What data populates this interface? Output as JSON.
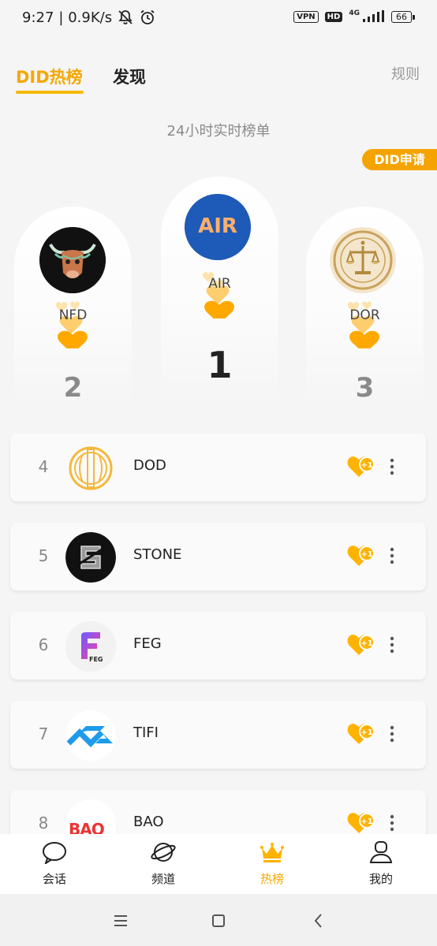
{
  "status_bar": {
    "time": "9:27",
    "network_speed": "| 0.9K/s",
    "vpn": "VPN",
    "hd": "HD",
    "signal_type": "4G",
    "battery": "66"
  },
  "tabs": [
    {
      "label": "DID热榜",
      "active": true
    },
    {
      "label": "发现",
      "active": false
    }
  ],
  "rules_label": "规则",
  "subtitle": "24小时实时榜单",
  "did_apply_label": "DID申请",
  "podium": [
    {
      "rank": "1",
      "name": "AIR",
      "logo_text": "AIR"
    },
    {
      "rank": "2",
      "name": "NFD"
    },
    {
      "rank": "3",
      "name": "DOR"
    }
  ],
  "list": [
    {
      "rank": "4",
      "name": "DOD"
    },
    {
      "rank": "5",
      "name": "STONE"
    },
    {
      "rank": "6",
      "name": "FEG",
      "logo_text": "FEG"
    },
    {
      "rank": "7",
      "name": "TIFI"
    },
    {
      "rank": "8",
      "name": "BAO",
      "logo_text": "BAO"
    }
  ],
  "like_badge": "+1",
  "bottom_nav": [
    {
      "label": "会话",
      "icon": "chat-bubble-icon",
      "active": false
    },
    {
      "label": "频道",
      "icon": "planet-icon",
      "active": false
    },
    {
      "label": "热榜",
      "icon": "crown-icon",
      "active": true
    },
    {
      "label": "我的",
      "icon": "person-icon",
      "active": false
    }
  ],
  "colors": {
    "accent": "#f5a800",
    "background": "#f5f5f5",
    "heart": "#ffb300"
  }
}
